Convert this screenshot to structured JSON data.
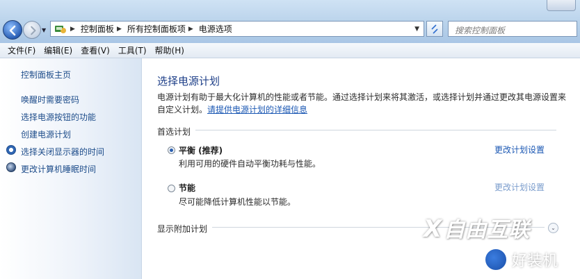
{
  "address_bar": {
    "breadcrumbs": [
      "控制面板",
      "所有控制面板项",
      "电源选项"
    ],
    "search_placeholder": "搜索控制面板"
  },
  "menu": [
    "文件(F)",
    "编辑(E)",
    "查看(V)",
    "工具(T)",
    "帮助(H)"
  ],
  "sidebar": {
    "home": "控制面板主页",
    "items": [
      {
        "label": "唤醒时需要密码",
        "icon": null
      },
      {
        "label": "选择电源按钮的功能",
        "icon": null
      },
      {
        "label": "创建电源计划",
        "icon": null
      },
      {
        "label": "选择关闭显示器的时间",
        "icon": "clock-icon"
      },
      {
        "label": "更改计算机睡眠时间",
        "icon": "moon-icon"
      }
    ]
  },
  "main": {
    "title": "选择电源计划",
    "description": "电源计划有助于最大化计算机的性能或者节能。通过选择计划来将其激活，或选择计划并通过更改其电源设置来自定义计划。",
    "description_link": "请提供电源计划的详细信息",
    "preferred_group": "首选计划",
    "plans": [
      {
        "name": "平衡 (推荐)",
        "desc": "利用可用的硬件自动平衡功耗与性能。",
        "link": "更改计划设置",
        "selected": true
      },
      {
        "name": "节能",
        "desc": "尽可能降低计算机性能以节能。",
        "link": "更改计划设置",
        "selected": false
      }
    ],
    "more_plans": "显示附加计划"
  },
  "watermarks": {
    "primary": "自由互联",
    "secondary": "好装机"
  },
  "colors": {
    "link": "#1a57b3",
    "title": "#1e3f88",
    "sidebar_link": "#1d4c8a"
  }
}
